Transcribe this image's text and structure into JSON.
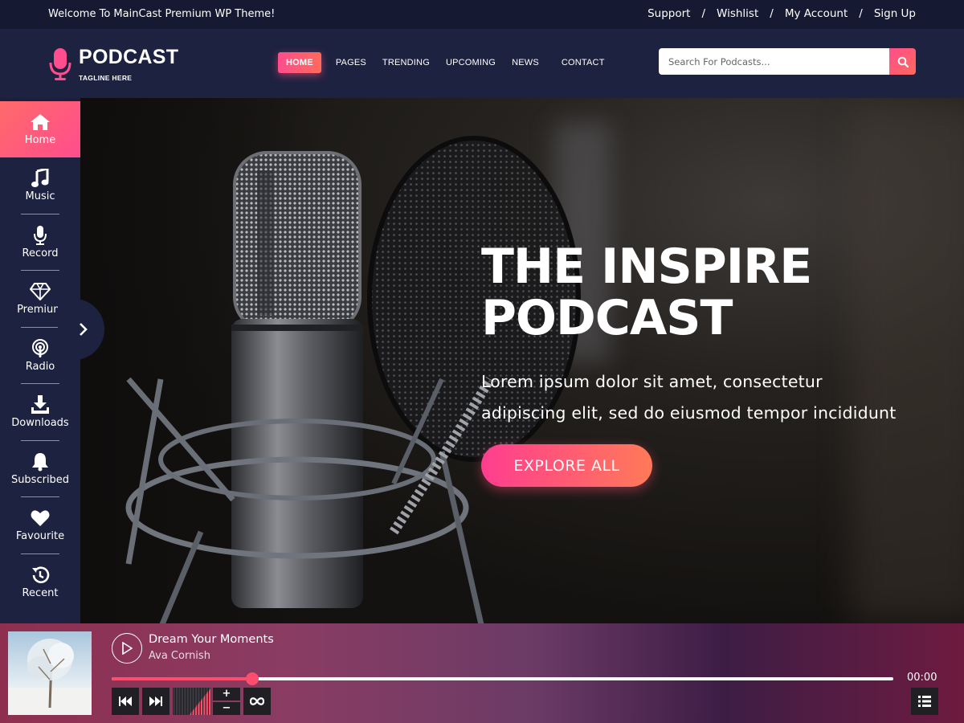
{
  "topbar": {
    "welcome": "Welcome To MainCast Premium WP Theme!",
    "links": [
      "Support",
      "Wishlist",
      "My Account",
      "Sign Up"
    ],
    "separator": "/"
  },
  "brand": {
    "title": "PODCAST",
    "tagline": "TAGLINE HERE",
    "accent": "#ff4d8d"
  },
  "nav": {
    "items": [
      "HOME",
      "PAGES",
      "TRENDING",
      "UPCOMING",
      "NEWS",
      "CONTACT"
    ],
    "active": "HOME"
  },
  "search": {
    "placeholder": "Search For Podcasts...",
    "icon": "search-icon"
  },
  "sidebar": {
    "items": [
      {
        "label": "Home",
        "icon": "home-icon"
      },
      {
        "label": "Music",
        "icon": "music-note-icon"
      },
      {
        "label": "Record",
        "icon": "microphone-icon"
      },
      {
        "label": "Premium",
        "icon": "diamond-icon"
      },
      {
        "label": "Radio",
        "icon": "podcast-icon"
      },
      {
        "label": "Downloads",
        "icon": "download-icon"
      },
      {
        "label": "Subscribed",
        "icon": "bell-icon"
      },
      {
        "label": "Favourite",
        "icon": "heart-icon"
      },
      {
        "label": "Recent",
        "icon": "history-icon"
      }
    ],
    "active": "Home",
    "toggle_icon": "chevron-right-icon"
  },
  "hero": {
    "title_line1": "THE INSPIRE",
    "title_line2": "PODCAST",
    "desc_line1": "Lorem ipsum dolor sit amet, consectetur",
    "desc_line2": "adipiscing elit, sed do eiusmod tempor incididunt",
    "button": "EXPLORE ALL"
  },
  "player": {
    "title": "Dream Your Moments",
    "artist": "Ava Cornish",
    "time": "00:00",
    "progress": 0.18,
    "volume": 0.6,
    "volume_up": "+",
    "volume_down": "−",
    "controls": [
      "previous-icon",
      "next-icon",
      "loop-icon",
      "playlist-icon"
    ]
  }
}
